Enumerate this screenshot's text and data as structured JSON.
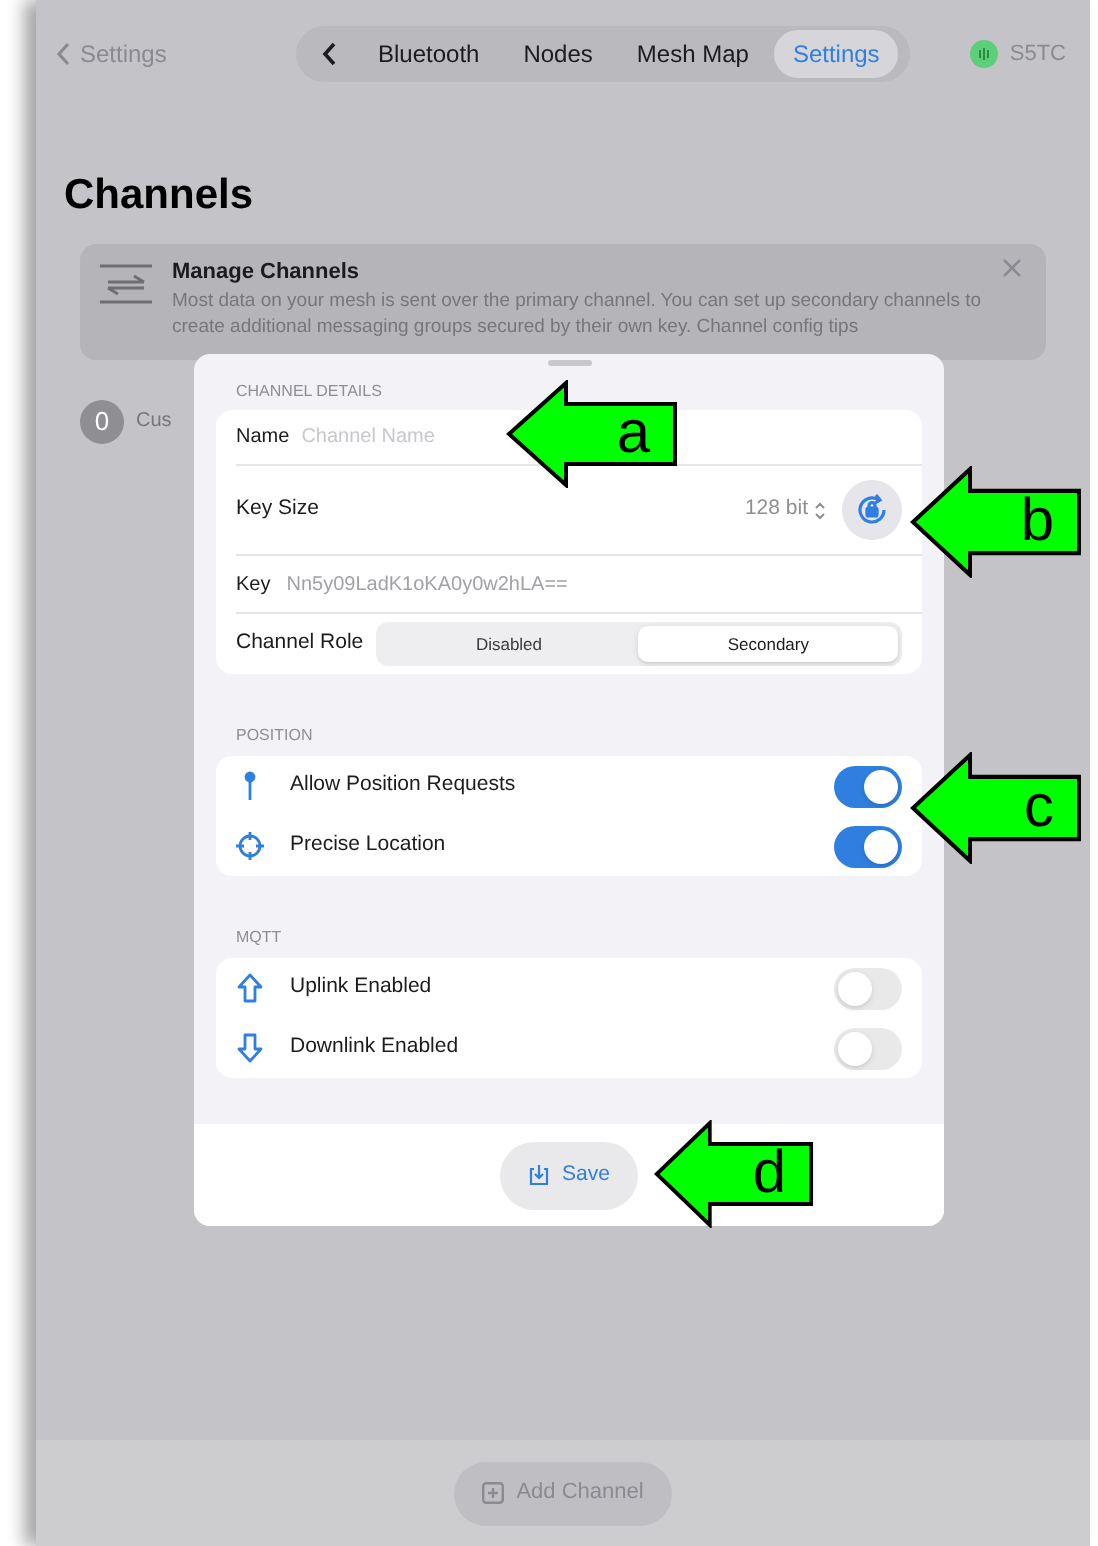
{
  "nav": {
    "back_label": "Settings",
    "tabs": [
      {
        "label": "Bluetooth",
        "selected": false
      },
      {
        "label": "Nodes",
        "selected": false
      },
      {
        "label": "Mesh Map",
        "selected": false
      },
      {
        "label": "Settings",
        "selected": true
      }
    ],
    "device_name": "S5TC"
  },
  "title": "Channels",
  "tip": {
    "title": "Manage Channels",
    "text": "Most data on your mesh is sent over the primary channel. You can set up secondary channels to create additional messaging groups secured by their own key. Channel config tips"
  },
  "channel_peek": {
    "index": "0",
    "name": "Cus"
  },
  "sheet": {
    "details_header": "CHANNEL DETAILS",
    "name": {
      "label": "Name",
      "placeholder": "Channel Name"
    },
    "key_size": {
      "label": "Key Size",
      "value": "128 bit"
    },
    "key": {
      "label": "Key",
      "value": "Nn5y09LadK1oKA0y0w2hLA=="
    },
    "role": {
      "label": "Channel Role",
      "options": [
        {
          "label": "Disabled",
          "selected": false
        },
        {
          "label": "Secondary",
          "selected": true
        }
      ]
    },
    "sections": [
      {
        "header": "POSITION",
        "rows": [
          {
            "kind": "pin",
            "label": "Allow Position Requests",
            "on": true
          },
          {
            "kind": "crosshair",
            "label": "Precise Location",
            "on": true
          }
        ]
      },
      {
        "header": "MQTT",
        "rows": [
          {
            "kind": "up",
            "label": "Uplink Enabled",
            "on": false
          },
          {
            "kind": "down",
            "label": "Downlink Enabled",
            "on": false
          }
        ]
      }
    ],
    "save": "Save"
  },
  "add_channel": "Add Channel",
  "callouts": [
    {
      "label": "a"
    },
    {
      "label": "b"
    },
    {
      "label": "c"
    },
    {
      "label": "d"
    }
  ]
}
